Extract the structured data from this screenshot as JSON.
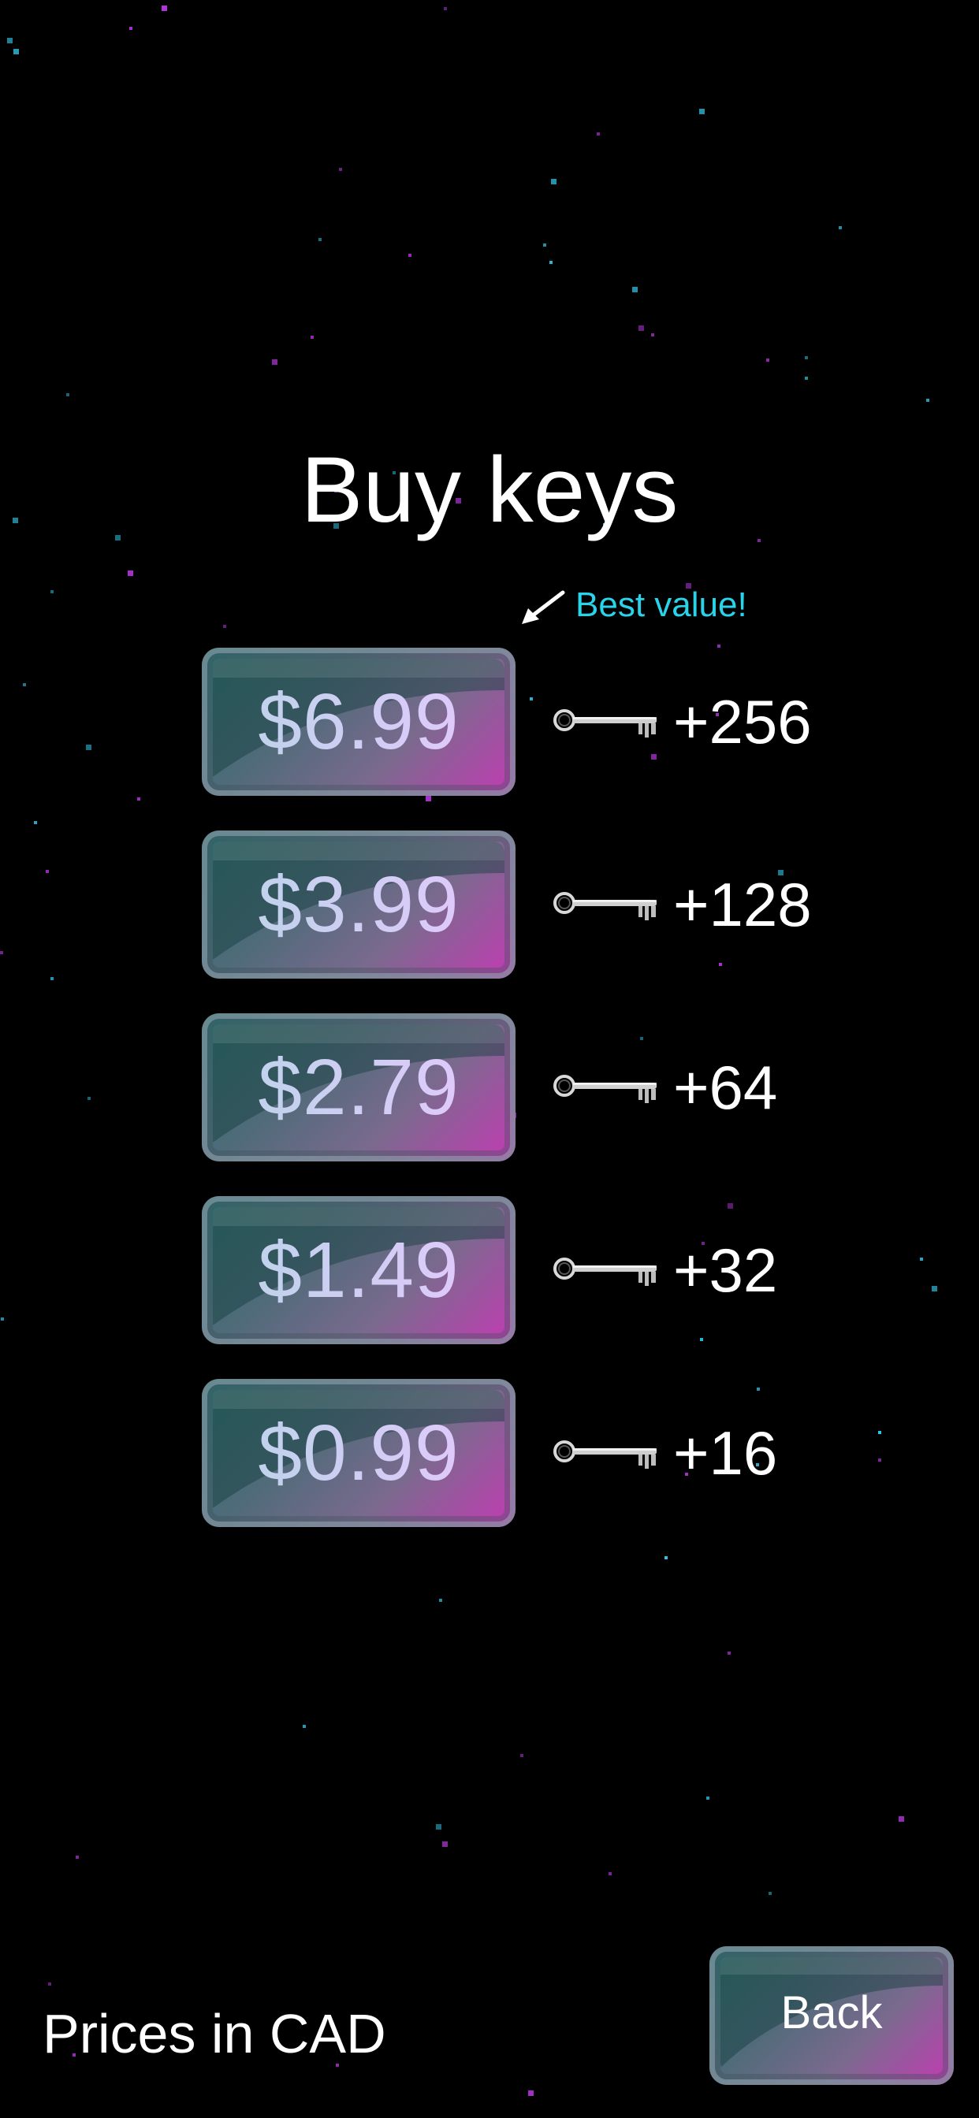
{
  "screen": {
    "title": "Buy keys",
    "best_value_label": "Best value!",
    "footer_note": "Prices in CAD",
    "back_label": "Back"
  },
  "offers": [
    {
      "price": "$6.99",
      "keys": "+256",
      "best_value": true
    },
    {
      "price": "$3.99",
      "keys": "+128",
      "best_value": false
    },
    {
      "price": "$2.79",
      "keys": "+64",
      "best_value": false
    },
    {
      "price": "$1.49",
      "keys": "+32",
      "best_value": false
    },
    {
      "price": "$0.99",
      "keys": "+16",
      "best_value": false
    }
  ],
  "icons": {
    "key": "key-icon",
    "arrow": "arrow-icon"
  },
  "colors": {
    "background": "#000000",
    "best_value_accent": "#29d4ea",
    "button_teal": "#2e6e6e",
    "button_magenta": "#c43ab4",
    "star_cyan": "#2fc6e8",
    "star_magenta": "#b034d8"
  }
}
